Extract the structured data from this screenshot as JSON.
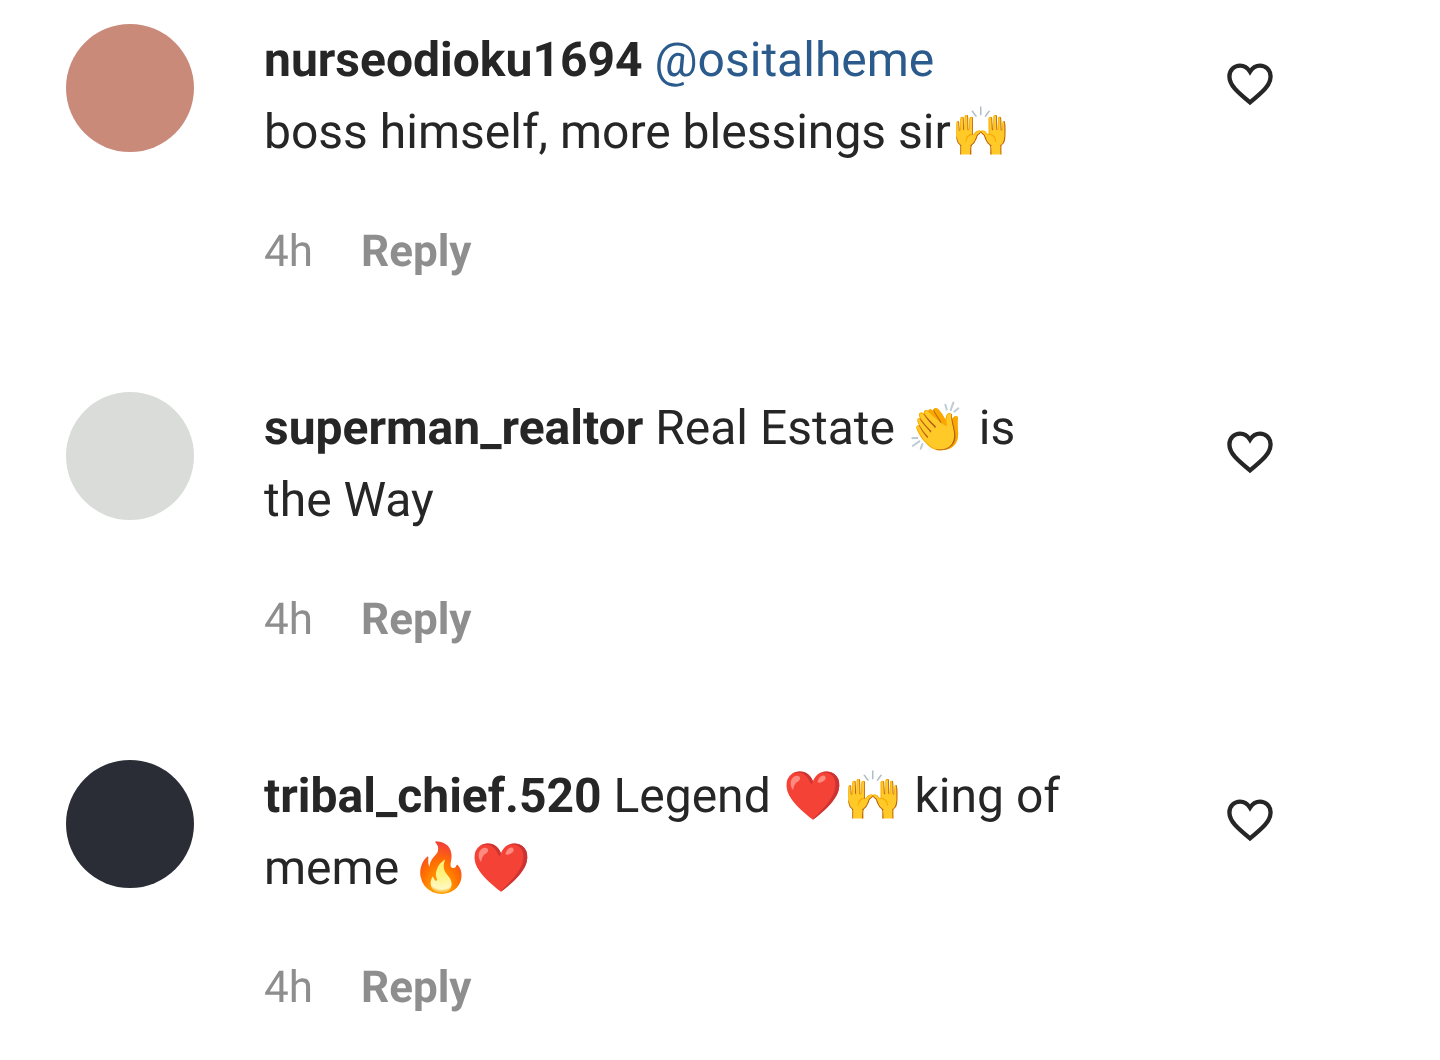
{
  "comments": [
    {
      "username": "nurseodioku1694",
      "mention": "@ositalheme",
      "text": "boss himself, more blessings sir🙌",
      "time": "4h",
      "reply": "Reply",
      "liked": false
    },
    {
      "username": "superman_realtor",
      "text": "Real Estate 👏 is the Way",
      "time": "4h",
      "reply": "Reply",
      "liked": false
    },
    {
      "username": "tribal_chief.520",
      "text": "Legend ❤️🙌 king of meme 🔥❤️",
      "time": "4h",
      "reply": "Reply",
      "liked": false
    }
  ]
}
